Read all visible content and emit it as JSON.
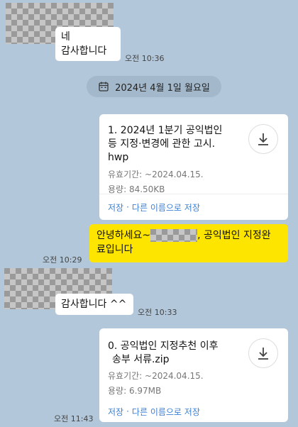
{
  "messages": [
    {
      "id": "m1",
      "text_lines": [
        "네",
        "감사합니다"
      ],
      "time": "오전 10:36"
    },
    {
      "id": "m2",
      "text_lines": [
        "안녕하세요~",
        "공익법인 지정완",
        "료입니다"
      ],
      "time": "오전 10:29"
    },
    {
      "id": "m3",
      "text": "감사합니다 ^^",
      "time": "오전 10:33"
    }
  ],
  "date_divider": {
    "label": "2024년 4월 1일 월요일",
    "icon": "calendar-icon"
  },
  "files": [
    {
      "title_lines": [
        "1. 2024년 1분기 공익법인",
        "등 지정·변경에 관한 고시.",
        "hwp"
      ],
      "validity": "유효기간: ~2024.04.15.",
      "size": "용량: 84.50KB",
      "save": "저장",
      "sep": "·",
      "save_as": "다른 이름으로 저장",
      "icon": "download-icon"
    },
    {
      "title_lines": [
        "0. 공익법인 지정추천 이후",
        "송부 서류.zip"
      ],
      "validity": "유효기간: ~2024.04.15.",
      "size": "용량: 6.97MB",
      "save": "저장",
      "sep": "·",
      "save_as": "다른 이름으로 저장",
      "icon": "download-icon",
      "time": "오전 11:43"
    }
  ],
  "colors": {
    "background": "#b2c7da",
    "yellow_bubble": "#fee500",
    "link": "#3b7fd4"
  }
}
